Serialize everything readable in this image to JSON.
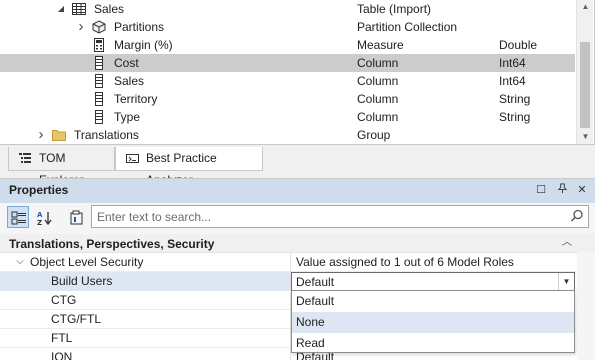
{
  "tree": {
    "rows": [
      {
        "name": "Sales",
        "type": "Table (Import)",
        "datatype": "",
        "indent": 0,
        "arrow": "expanded",
        "icon": "table-icon",
        "selected": false
      },
      {
        "name": "Partitions",
        "type": "Partition Collection",
        "datatype": "",
        "indent": 1,
        "arrow": "collapsed",
        "icon": "partitions-icon",
        "selected": false
      },
      {
        "name": "Margin (%)",
        "type": "Measure",
        "datatype": "Double",
        "indent": 1,
        "arrow": "none",
        "icon": "measure-icon",
        "selected": false
      },
      {
        "name": "Cost",
        "type": "Column",
        "datatype": "Int64",
        "indent": 1,
        "arrow": "none",
        "icon": "column-icon",
        "selected": true
      },
      {
        "name": "Sales",
        "type": "Column",
        "datatype": "Int64",
        "indent": 1,
        "arrow": "none",
        "icon": "column-icon",
        "selected": false
      },
      {
        "name": "Territory",
        "type": "Column",
        "datatype": "String",
        "indent": 1,
        "arrow": "none",
        "icon": "column-icon",
        "selected": false
      },
      {
        "name": "Type",
        "type": "Column",
        "datatype": "String",
        "indent": 1,
        "arrow": "none",
        "icon": "column-icon",
        "selected": false
      },
      {
        "name": "Translations",
        "type": "Group",
        "datatype": "",
        "indent": -1,
        "arrow": "collapsed",
        "icon": "folder-icon",
        "selected": false
      }
    ]
  },
  "tabs": [
    {
      "label": "TOM Explorer",
      "icon": "tom-explorer-icon",
      "active": false
    },
    {
      "label": "Best Practice Analyzer",
      "icon": "bpa-icon",
      "active": true
    }
  ],
  "properties": {
    "title": "Properties",
    "header_buttons": [
      "maximize-icon",
      "pin-icon",
      "close-icon"
    ],
    "toolbar": {
      "categorized_icon": "categorized-icon",
      "alphabetical_icon": "alphabetical-icon",
      "property_pages_icon": "property-pages-icon"
    },
    "search": {
      "placeholder": "Enter text to search...",
      "value": ""
    },
    "category": "Translations, Perspectives, Security",
    "rows": [
      {
        "name": "Object Level Security",
        "value": "Value assigned to 1 out of 6 Model Roles",
        "expandable": true,
        "selected": false
      },
      {
        "name": "Build Users",
        "value": "Default",
        "expandable": false,
        "selected": true
      },
      {
        "name": "CTG",
        "value": "",
        "expandable": false,
        "selected": false
      },
      {
        "name": "CTG/FTL",
        "value": "",
        "expandable": false,
        "selected": false
      },
      {
        "name": "FTL",
        "value": "",
        "expandable": false,
        "selected": false
      },
      {
        "name": "ION",
        "value": "Default",
        "expandable": false,
        "selected": false
      }
    ],
    "dropdown": {
      "current": "Default",
      "options": [
        "Default",
        "None",
        "Read"
      ],
      "highlighted": "None"
    }
  },
  "colors": {
    "header_bg": "#cfdcec",
    "selection": "#cccccc",
    "highlight": "#dde6f2"
  }
}
